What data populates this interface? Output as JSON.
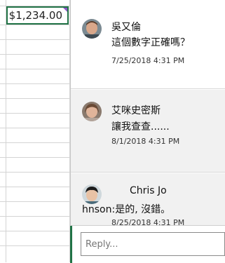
{
  "cell": {
    "value": "$1,234.00"
  },
  "comments": [
    {
      "author": "吳又倫",
      "body": "這個數字正確嗎？",
      "time": "7/25/2018 4:31 PM"
    },
    {
      "author": "艾咪史密斯",
      "body": "讓我查查......",
      "time": "8/1/2018 4:31 PM"
    },
    {
      "author": "Chris Jo",
      "body": "hnson:是的, 沒錯。",
      "time": "8/25/2018 4:31 PM"
    }
  ],
  "reply": {
    "placeholder": "Reply..."
  },
  "colors": {
    "accent": "#217346",
    "comment_indicator": "#8d58c6"
  }
}
